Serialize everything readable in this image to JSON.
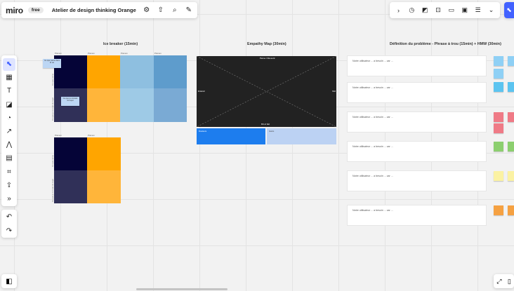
{
  "topbar": {
    "logo": "miro",
    "plan_badge": "free",
    "board_title": "Atelier de design thinking Orange",
    "icons": [
      "settings-icon",
      "upload-icon",
      "search-icon",
      "magic-icon"
    ]
  },
  "collab_bar": {
    "icons": [
      "chevron-right-icon",
      "timer-icon",
      "sticky-share-icon",
      "screen-icon",
      "comment-icon",
      "notes-icon",
      "list-icon",
      "double-chevron-down-icon"
    ]
  },
  "toolbar": {
    "tools": [
      {
        "name": "select",
        "glyph": "⬉"
      },
      {
        "name": "templates",
        "glyph": "▦"
      },
      {
        "name": "text",
        "glyph": "T"
      },
      {
        "name": "sticky-note",
        "glyph": "◪"
      },
      {
        "name": "shapes",
        "glyph": "◔"
      },
      {
        "name": "arrow",
        "glyph": "↗"
      },
      {
        "name": "pen",
        "glyph": "⋀"
      },
      {
        "name": "comment",
        "glyph": "▤"
      },
      {
        "name": "frame",
        "glyph": "⌗"
      },
      {
        "name": "upload",
        "glyph": "⇪"
      },
      {
        "name": "more",
        "glyph": "»"
      }
    ],
    "undo_glyph": "↶",
    "redo_glyph": "↷"
  },
  "frames": {
    "icebreaker": "Ice breaker (15min)",
    "empathy": "Empathy Map (30min)",
    "problem": "Définition du problème - Phrase à trou (15min) + HMW (30min)"
  },
  "icebreaker": {
    "col_label": "Prénom",
    "row_label_1": "Ce que j'aime",
    "row_label_2": "Ce que je connais du sujet",
    "sticky_1": "Ce que j'aime dans la vie",
    "sticky_2": "Ce que je connais du sujet"
  },
  "empathy": {
    "top_label": "Pense / Ressent",
    "left_label": "Entend",
    "right_label": "Voit",
    "bottom_label": "Dit et fait",
    "box_left": "Douleurs",
    "box_right": "Gains"
  },
  "problem": {
    "card_text": "Notre utilisateur ... a besoin ... car ..."
  },
  "colors": {
    "navy": "#050437",
    "orange": "#ffa500",
    "purple": "#303058",
    "light_orange": "#ffb53a",
    "blue1": "#8ebfe0",
    "blue2": "#5e9ccc",
    "blue3": "#9ecae6",
    "blue4": "#7aaad4",
    "empathy_bg": "#222222",
    "empathy_blue": "#1d7dee",
    "empathy_lightblue": "#bcd2f3"
  }
}
